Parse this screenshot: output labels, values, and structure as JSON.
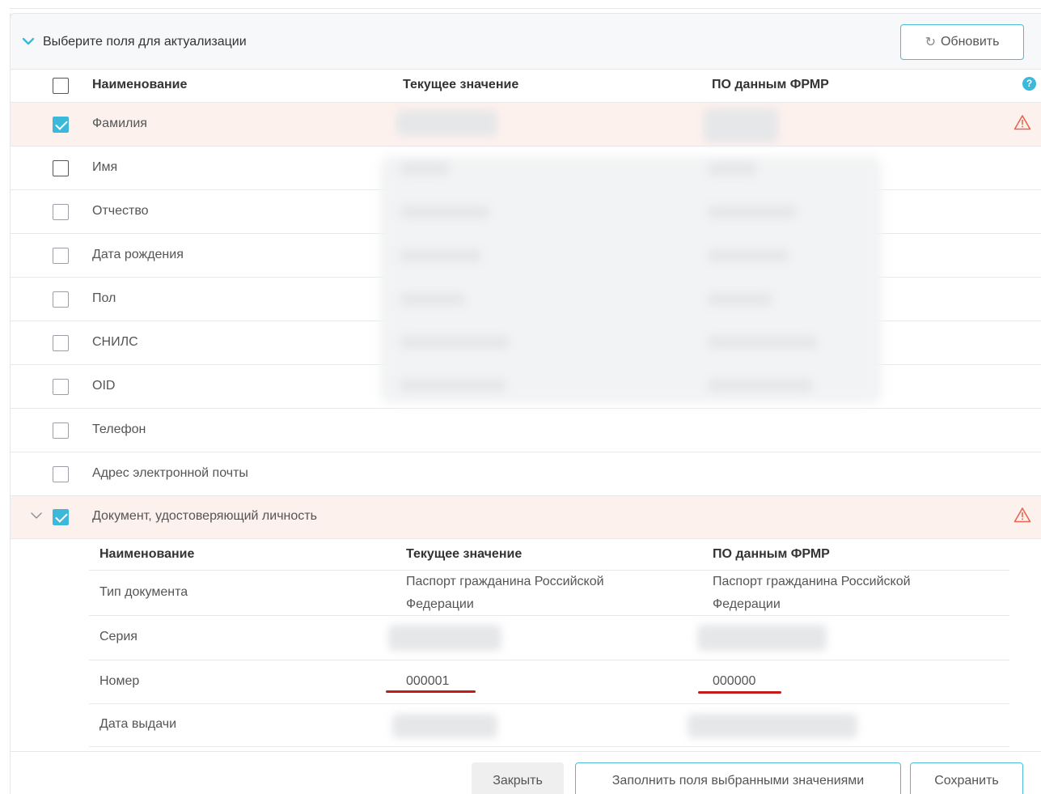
{
  "panel": {
    "title": "Выберите поля для актуализации",
    "refresh_label": "Обновить"
  },
  "columns": {
    "name": "Наименование",
    "current": "Текущее значение",
    "frmr": "ПО данным ФРМР"
  },
  "fields": [
    {
      "label": "Фамилия",
      "checked": true,
      "highlighted": true,
      "warning": true
    },
    {
      "label": "Имя",
      "checked": false
    },
    {
      "label": "Отчество",
      "checked": false
    },
    {
      "label": "Дата рождения",
      "checked": false
    },
    {
      "label": "Пол",
      "checked": false
    },
    {
      "label": "СНИЛС",
      "checked": false
    },
    {
      "label": "OID",
      "checked": false
    },
    {
      "label": "Телефон",
      "checked": false
    },
    {
      "label": "Адрес электронной почты",
      "checked": false
    }
  ],
  "document": {
    "label": "Документ, удостоверяющий личность",
    "checked": true,
    "warning": true,
    "columns": {
      "name": "Наименование",
      "current": "Текущее значение",
      "frmr": "ПО данным ФРМР"
    },
    "rows": [
      {
        "name": "Тип документа",
        "current": "Паспорт гражданина Российской Федерации",
        "frmr": "Паспорт гражданина Российской Федерации"
      },
      {
        "name": "Серия",
        "current": "",
        "frmr": ""
      },
      {
        "name": "Номер",
        "current": "000001",
        "frmr": "000000"
      },
      {
        "name": "Дата выдачи",
        "current": "",
        "frmr": ""
      }
    ]
  },
  "buttons": {
    "close": "Закрыть",
    "fill": "Заполнить поля выбранными значениями",
    "save": "Сохранить"
  },
  "colors": {
    "accent": "#3bb8da",
    "highlight_row": "#fdf1ee",
    "warning": "#e8654f",
    "annotation_underline": "#c41a1a"
  }
}
